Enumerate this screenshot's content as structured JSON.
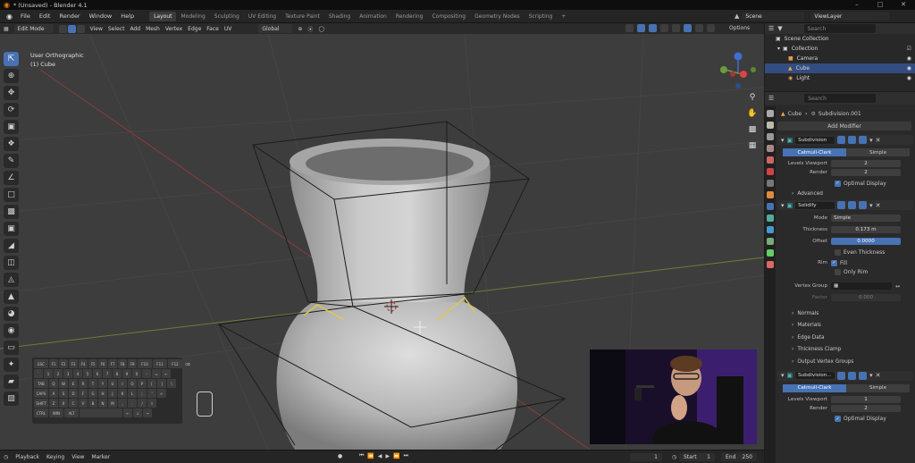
{
  "window": {
    "title": "* (Unsaved) - Blender 4.1"
  },
  "menu": [
    "File",
    "Edit",
    "Render",
    "Window",
    "Help"
  ],
  "workspaces": [
    "Layout",
    "Modeling",
    "Sculpting",
    "UV Editing",
    "Texture Paint",
    "Shading",
    "Animation",
    "Rendering",
    "Compositing",
    "Geometry Nodes",
    "Scripting"
  ],
  "workspace_add": "+",
  "scene": {
    "label": "Scene",
    "viewlayer": "ViewLayer"
  },
  "viewport_header": {
    "mode": "Edit Mode",
    "menus": [
      "View",
      "Select",
      "Add",
      "Mesh",
      "Vertex",
      "Edge",
      "Face",
      "UV"
    ],
    "orientation": "Global",
    "options": "Options"
  },
  "viewport": {
    "line1": "User Orthographic",
    "line2": "(1) Cube"
  },
  "gizmo": {
    "x": "X",
    "y": "Y",
    "z": "Z"
  },
  "keyboard": {
    "rows": [
      [
        "ESC",
        "F1",
        "F2",
        "F3",
        "F4",
        "F5",
        "F6",
        "F7",
        "F8",
        "F9",
        "F10",
        "F11",
        "F12",
        "⌫"
      ],
      [
        "`",
        "1",
        "2",
        "3",
        "4",
        "5",
        "6",
        "7",
        "8",
        "9",
        "0",
        "-",
        "=",
        "←"
      ],
      [
        "TAB",
        "Q",
        "W",
        "E",
        "R",
        "T",
        "Y",
        "U",
        "I",
        "O",
        "P",
        "[",
        "]",
        "\\"
      ],
      [
        "CAPS",
        "A",
        "S",
        "D",
        "F",
        "G",
        "H",
        "J",
        "K",
        "L",
        ";",
        "'",
        "↵"
      ],
      [
        "SHIFT",
        "Z",
        "X",
        "C",
        "V",
        "B",
        "N",
        "M",
        ",",
        ".",
        "/",
        "⇧"
      ],
      [
        "CTRL",
        "WIN",
        "ALT",
        "",
        "←",
        "↓",
        "→"
      ]
    ]
  },
  "timeline": {
    "playback": "Playback",
    "keying": "Keying",
    "view": "View",
    "marker": "Marker",
    "frame": "1",
    "start_label": "Start",
    "start": "1",
    "end_label": "End",
    "end": "250"
  },
  "outliner": {
    "search_placeholder": "Search",
    "items": [
      {
        "label": "Scene Collection"
      },
      {
        "label": "Collection"
      },
      {
        "label": "Camera"
      },
      {
        "label": "Cube"
      },
      {
        "label": "Light"
      }
    ]
  },
  "properties": {
    "search_placeholder": "Search",
    "breadcrumb": {
      "object": "Cube",
      "modifier": "Subdivision.001"
    },
    "add_modifier": "Add Modifier",
    "mod1": {
      "name": "Subdivision",
      "type_options": [
        "Catmull-Clark",
        "Simple"
      ],
      "levels_viewport_label": "Levels Viewport",
      "levels_viewport": "2",
      "render_label": "Render",
      "render": "2",
      "optimal_display": "Optimal Display",
      "advanced": "Advanced"
    },
    "mod2": {
      "name": "Solidify",
      "mode_label": "Mode",
      "mode": "Simple",
      "thickness_label": "Thickness",
      "thickness": "0.173 m",
      "offset_label": "Offset",
      "offset": "0.0000",
      "even_thickness": "Even Thickness",
      "rim_label": "Rim",
      "fill": "Fill",
      "only_rim": "Only Rim",
      "vertex_group_label": "Vertex Group",
      "factor_label": "Factor",
      "factor": "0.000",
      "sections": [
        "Normals",
        "Materials",
        "Edge Data",
        "Thickness Clamp",
        "Output Vertex Groups"
      ]
    },
    "mod3": {
      "name": "Subdivision...",
      "type_options": [
        "Catmull-Clark",
        "Simple"
      ],
      "levels_viewport_label": "Levels Viewport",
      "levels_viewport": "1",
      "render_label": "Render",
      "render": "2",
      "optimal_display": "Optimal Display"
    }
  },
  "colors": {
    "accent": "#4772b3",
    "viewport_bg": "#3d3d3d",
    "selected": "#334d80"
  }
}
